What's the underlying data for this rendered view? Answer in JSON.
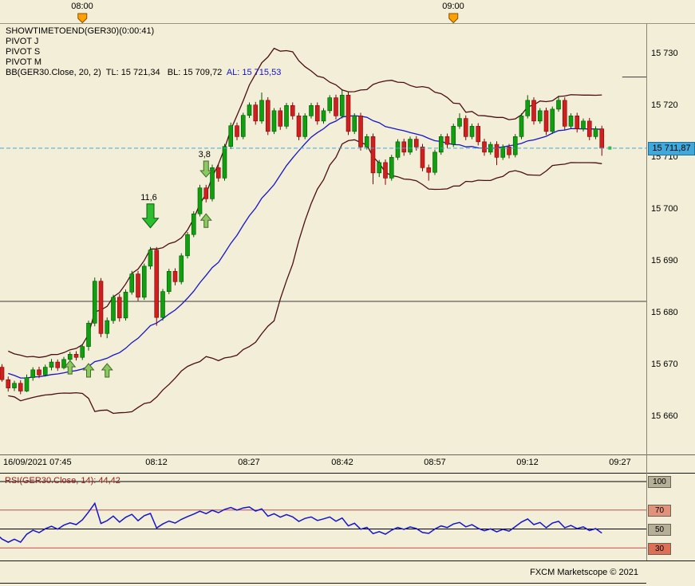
{
  "legend": {
    "showtime": "SHOWTIMETOEND(GER30)(0:00:41)",
    "pivot_j": "PIVOT J",
    "pivot_s": "PIVOT S",
    "pivot_m": "PIVOT M",
    "bb": "BB(GER30.Close, 20, 2)  TL: 15 721,34   BL: 15 709,72  ",
    "bb_al": "AL: 15 715,53"
  },
  "chart": {
    "top_axis": [
      "08:00",
      "09:00"
    ],
    "price_axis": [
      "15 730",
      "15 720",
      "15 710",
      "15 700",
      "15 690",
      "15 680",
      "15 670",
      "15 660"
    ],
    "current_price_label": "15 711,87",
    "time_axis": [
      "16/09/2021 07:45",
      "08:12",
      "08:27",
      "08:42",
      "08:57",
      "09:12",
      "09:27"
    ]
  },
  "rsi": {
    "label": "RSI(GER30.Close, 14): 44,42",
    "levels": [
      "100",
      "70",
      "50",
      "30"
    ]
  },
  "footer": {
    "copyright": "FXCM Marketscope © 2021"
  },
  "chart_data": {
    "type": "candlestick",
    "symbol": "GER30",
    "date": "16/09/2021",
    "start_time": "07:45",
    "interval_minutes": 1,
    "current_price": 15711.87,
    "ylim": [
      15655,
      15733
    ],
    "bollinger": {
      "period": 20,
      "deviation": 2,
      "tl": 15721.34,
      "bl": 15709.72,
      "al": 15715.53
    },
    "rsi": {
      "period": 14,
      "value": 44.42,
      "levels": [
        100,
        70,
        50,
        30
      ]
    },
    "hour_marks_minutes": [
      15,
      75
    ],
    "pivot_segments": [
      {
        "price": 15682.3,
        "from_minute": -2,
        "to_minute": 106.5
      },
      {
        "price": 15725.6,
        "from_minute": 102.3,
        "to_minute": 106.5
      }
    ],
    "marks": [
      {
        "dir": "up",
        "minute": 13,
        "price": 15670.9
      },
      {
        "dir": "up",
        "minute": 16,
        "price": 15670.3
      },
      {
        "dir": "up",
        "minute": 19,
        "price": 15670.3
      },
      {
        "dir": "up",
        "minute": 35,
        "price": 15699.2
      },
      {
        "dir": "down",
        "minute": 26,
        "price": 15696.5,
        "label": "11,6",
        "size": "large"
      },
      {
        "dir": "down",
        "minute": 35,
        "price": 15706.3,
        "label": "3,8",
        "size": "small"
      },
      {
        "dir": "dot",
        "minute": 100.3,
        "price": 15711.9
      }
    ],
    "colors": {
      "up": "#0f9f0f",
      "up_stroke": "#005500",
      "down": "#d01f1f",
      "down_stroke": "#7d0606",
      "band": "#4a0f14",
      "mid": "#1414cc",
      "rsi": "#1414cc",
      "current": "#3aabdc",
      "pivot": "#3c3c3c",
      "level_red": "#c24c4c",
      "arrow_green": "#2ebd2e",
      "arrow_stroke": "#0d5c0d",
      "arrow_light": "#8cc763",
      "arrow_light_stroke": "#3f6b22",
      "marker_orange": "#ffa000"
    },
    "ohlc": [
      [
        15672.6,
        15673.4,
        15670.8,
        15671.2
      ],
      [
        15671.2,
        15671.8,
        15669.0,
        15669.6
      ],
      [
        15669.6,
        15670.2,
        15666.8,
        15667.2
      ],
      [
        15667.2,
        15667.8,
        15664.9,
        15665.6
      ],
      [
        15665.6,
        15667.0,
        15665.0,
        15666.5
      ],
      [
        15666.5,
        15667.1,
        15664.4,
        15665.0
      ],
      [
        15665.0,
        15668.2,
        15664.8,
        15667.6
      ],
      [
        15667.6,
        15669.6,
        15667.0,
        15669.1
      ],
      [
        15669.1,
        15669.7,
        15667.5,
        15668.1
      ],
      [
        15668.1,
        15670.1,
        15667.8,
        15669.6
      ],
      [
        15669.6,
        15671.2,
        15669.0,
        15670.6
      ],
      [
        15670.6,
        15671.1,
        15668.9,
        15669.5
      ],
      [
        15669.5,
        15671.6,
        15669.2,
        15671.1
      ],
      [
        15671.1,
        15672.6,
        15670.3,
        15672.1
      ],
      [
        15672.1,
        15672.7,
        15670.9,
        15671.5
      ],
      [
        15671.5,
        15674.1,
        15671.0,
        15673.6
      ],
      [
        15673.6,
        15678.6,
        15672.8,
        15678.1
      ],
      [
        15678.1,
        15686.9,
        15677.5,
        15686.2
      ],
      [
        15686.2,
        15686.8,
        15675.4,
        15676.1
      ],
      [
        15676.1,
        15679.2,
        15675.2,
        15678.6
      ],
      [
        15678.6,
        15683.6,
        15678.0,
        15683.1
      ],
      [
        15683.1,
        15683.7,
        15678.4,
        15679.1
      ],
      [
        15679.1,
        15684.6,
        15678.6,
        15684.1
      ],
      [
        15684.1,
        15688.2,
        15683.6,
        15687.6
      ],
      [
        15687.6,
        15688.2,
        15682.4,
        15683.1
      ],
      [
        15683.1,
        15689.6,
        15682.6,
        15689.1
      ],
      [
        15689.1,
        15692.8,
        15688.5,
        15692.2
      ],
      [
        15692.2,
        15692.8,
        15677.6,
        15679.2
      ],
      [
        15679.2,
        15684.7,
        15678.6,
        15684.2
      ],
      [
        15684.2,
        15688.6,
        15683.7,
        15688.1
      ],
      [
        15688.1,
        15688.7,
        15685.4,
        15686.1
      ],
      [
        15686.1,
        15691.6,
        15685.6,
        15691.1
      ],
      [
        15691.1,
        15695.7,
        15690.6,
        15695.2
      ],
      [
        15695.2,
        15699.7,
        15694.7,
        15699.2
      ],
      [
        15699.2,
        15704.8,
        15698.7,
        15704.2
      ],
      [
        15704.2,
        15704.8,
        15701.4,
        15702.1
      ],
      [
        15702.1,
        15708.7,
        15701.6,
        15708.1
      ],
      [
        15708.1,
        15708.7,
        15705.4,
        15706.1
      ],
      [
        15706.1,
        15712.7,
        15705.6,
        15712.2
      ],
      [
        15712.2,
        15716.8,
        15711.7,
        15716.2
      ],
      [
        15716.2,
        15716.8,
        15713.4,
        15714.1
      ],
      [
        15714.1,
        15718.7,
        15713.6,
        15718.2
      ],
      [
        15718.2,
        15720.7,
        15717.7,
        15720.2
      ],
      [
        15720.2,
        15720.8,
        15716.4,
        15717.1
      ],
      [
        15717.1,
        15722.6,
        15716.6,
        15721.1
      ],
      [
        15721.1,
        15721.7,
        15714.4,
        15715.1
      ],
      [
        15715.1,
        15719.6,
        15714.6,
        15719.1
      ],
      [
        15719.1,
        15719.7,
        15715.4,
        15716.1
      ],
      [
        15716.1,
        15720.6,
        15715.6,
        15720.1
      ],
      [
        15720.1,
        15720.7,
        15717.4,
        15718.1
      ],
      [
        15718.1,
        15718.7,
        15713.4,
        15714.1
      ],
      [
        15714.1,
        15718.6,
        15713.6,
        15718.1
      ],
      [
        15718.1,
        15720.6,
        15717.6,
        15720.1
      ],
      [
        15720.1,
        15720.7,
        15716.4,
        15717.1
      ],
      [
        15717.1,
        15719.6,
        15716.6,
        15719.1
      ],
      [
        15719.1,
        15722.1,
        15718.6,
        15721.6
      ],
      [
        15721.6,
        15722.2,
        15717.4,
        15718.1
      ],
      [
        15718.1,
        15723.1,
        15717.6,
        15722.1
      ],
      [
        15722.1,
        15722.7,
        15714.4,
        15715.1
      ],
      [
        15715.1,
        15718.6,
        15714.6,
        15718.1
      ],
      [
        15718.1,
        15718.7,
        15711.4,
        15712.1
      ],
      [
        15712.1,
        15714.6,
        15711.6,
        15714.1
      ],
      [
        15714.1,
        15714.7,
        15704.9,
        15707.1
      ],
      [
        15707.1,
        15709.6,
        15706.3,
        15709.1
      ],
      [
        15709.1,
        15709.7,
        15704.8,
        15706.1
      ],
      [
        15706.1,
        15710.6,
        15705.6,
        15710.1
      ],
      [
        15710.1,
        15713.6,
        15709.6,
        15713.1
      ],
      [
        15713.1,
        15713.7,
        15710.4,
        15711.1
      ],
      [
        15711.1,
        15714.1,
        15710.6,
        15713.6
      ],
      [
        15713.6,
        15714.2,
        15711.4,
        15712.1
      ],
      [
        15712.1,
        15712.7,
        15707.4,
        15708.1
      ],
      [
        15708.1,
        15708.7,
        15705.6,
        15707.2
      ],
      [
        15707.2,
        15711.6,
        15706.7,
        15711.1
      ],
      [
        15711.1,
        15714.6,
        15710.6,
        15714.1
      ],
      [
        15714.1,
        15714.7,
        15711.9,
        15712.6
      ],
      [
        15712.6,
        15716.6,
        15712.1,
        15716.1
      ],
      [
        15716.1,
        15718.6,
        15715.6,
        15717.6
      ],
      [
        15717.6,
        15718.2,
        15713.4,
        15714.1
      ],
      [
        15714.1,
        15716.6,
        15713.6,
        15716.1
      ],
      [
        15716.1,
        15716.7,
        15712.4,
        15713.1
      ],
      [
        15713.1,
        15713.7,
        15710.4,
        15711.1
      ],
      [
        15711.1,
        15713.1,
        15710.6,
        15712.6
      ],
      [
        15712.6,
        15713.2,
        15708.6,
        15710.1
      ],
      [
        15710.1,
        15712.6,
        15709.6,
        15712.1
      ],
      [
        15712.1,
        15712.7,
        15709.9,
        15710.6
      ],
      [
        15710.6,
        15714.6,
        15710.1,
        15714.1
      ],
      [
        15714.1,
        15718.6,
        15713.6,
        15718.1
      ],
      [
        15718.1,
        15722.1,
        15717.6,
        15721.1
      ],
      [
        15721.1,
        15721.7,
        15716.4,
        15717.1
      ],
      [
        15717.1,
        15719.6,
        15716.6,
        15719.1
      ],
      [
        15719.1,
        15719.7,
        15714.4,
        15715.1
      ],
      [
        15715.1,
        15719.9,
        15714.6,
        15719.4
      ],
      [
        15719.4,
        15722.0,
        15718.9,
        15721.1
      ],
      [
        15721.1,
        15721.7,
        15715.4,
        15716.1
      ],
      [
        15716.1,
        15718.6,
        15715.6,
        15718.1
      ],
      [
        15718.1,
        15718.7,
        15714.9,
        15715.6
      ],
      [
        15715.6,
        15717.6,
        15715.1,
        15717.1
      ],
      [
        15717.1,
        15717.7,
        15713.4,
        15714.1
      ],
      [
        15714.1,
        15716.1,
        15713.6,
        15715.6
      ],
      [
        15715.6,
        15716.2,
        15710.4,
        15711.87
      ]
    ]
  }
}
